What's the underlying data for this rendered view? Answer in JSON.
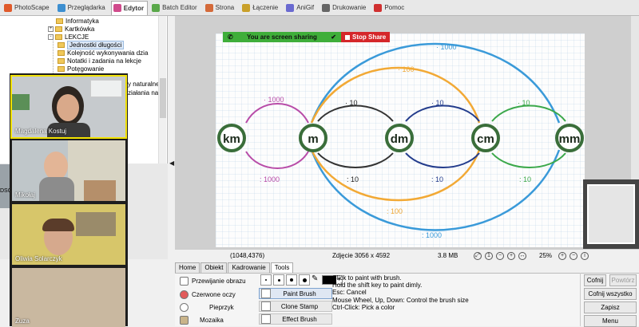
{
  "tabs": [
    {
      "label": "PhotoScape",
      "icon": "photoscape-icon",
      "color": "#e05a2b"
    },
    {
      "label": "Przeglądarka",
      "icon": "browser-icon",
      "color": "#3d8fd0"
    },
    {
      "label": "Edytor",
      "icon": "editor-icon",
      "color": "#d04b8c"
    },
    {
      "label": "Batch Editor",
      "icon": "batch-icon",
      "color": "#5aa84a"
    },
    {
      "label": "Strona",
      "icon": "page-icon",
      "color": "#d46a3a"
    },
    {
      "label": "Łączenie",
      "icon": "combine-icon",
      "color": "#c9a02a"
    },
    {
      "label": "AniGif",
      "icon": "anigif-icon",
      "color": "#6a6ad0"
    },
    {
      "label": "Drukowanie",
      "icon": "print-icon",
      "color": "#666666"
    },
    {
      "label": "Pomoc",
      "icon": "help-icon",
      "color": "#d03030"
    }
  ],
  "active_tab": "Edytor",
  "tree": {
    "items": [
      {
        "label": "Informatyka",
        "expander": ""
      },
      {
        "label": "Kartkówka",
        "expander": "+"
      },
      {
        "label": "LEKCJE",
        "expander": "-"
      },
      {
        "label": "Jednostki długości",
        "expander": "",
        "selected": true
      },
      {
        "label": "Kolejność wykonywania dzia",
        "expander": ""
      },
      {
        "label": "Notatki i zadania na lekcje",
        "expander": ""
      },
      {
        "label": "Potęgowanie",
        "expander": ""
      }
    ],
    "partial_1": "y naturalne",
    "partial_2": "ziałania na li"
  },
  "thumb_label": "DSC",
  "participants": [
    {
      "name": "Magdalena Kostuj",
      "active": true
    },
    {
      "name": "Mikołaj",
      "active": false
    },
    {
      "name": "Oliwia Solarczyk",
      "active": false
    },
    {
      "name": "Zuza",
      "active": false
    }
  ],
  "share_bar": {
    "status": "You are screen sharing",
    "stop": "Stop Share"
  },
  "chart_data": {
    "type": "diagram",
    "units": [
      "km",
      "m",
      "dm",
      "cm",
      "mm"
    ],
    "top_labels": [
      "· 1000",
      "· 10",
      "· 10",
      "· 10",
      "· 100",
      "· 1000"
    ],
    "bottom_labels": [
      ": 1000",
      ": 10",
      ": 10",
      ": 10",
      ": 100",
      ": 1000"
    ]
  },
  "status": {
    "coords": "(1048,4376)",
    "info": "Zdjęcie 3056 x 4592",
    "size": "3.8 MB",
    "zoom": "25%"
  },
  "bottom_tabs": [
    "Home",
    "Obiekt",
    "Kadrowanie",
    "Tools"
  ],
  "active_bottom_tab": "Tools",
  "tools": {
    "list": [
      "Przewijanie obrazu",
      "Czerwone oczy",
      "Pieprzyk",
      "Mozaika"
    ],
    "brushes": [
      "Paint Brush",
      "Clone Stamp",
      "Effect Brush"
    ],
    "active_brush": "Paint Brush",
    "help_lines": [
      "Click to paint with brush.",
      "Hold the shift key to paint dimly.",
      "Esc: Cancel",
      "Mouse Wheel, Up, Down: Control the brush size",
      "Ctrl-Click: Pick a color"
    ],
    "brush_color": "#000000"
  },
  "buttons": {
    "undo": "Cofnij",
    "redo": "Powtórz",
    "undo_all": "Cofnij wszystko",
    "save": "Zapisz",
    "menu": "Menu"
  }
}
